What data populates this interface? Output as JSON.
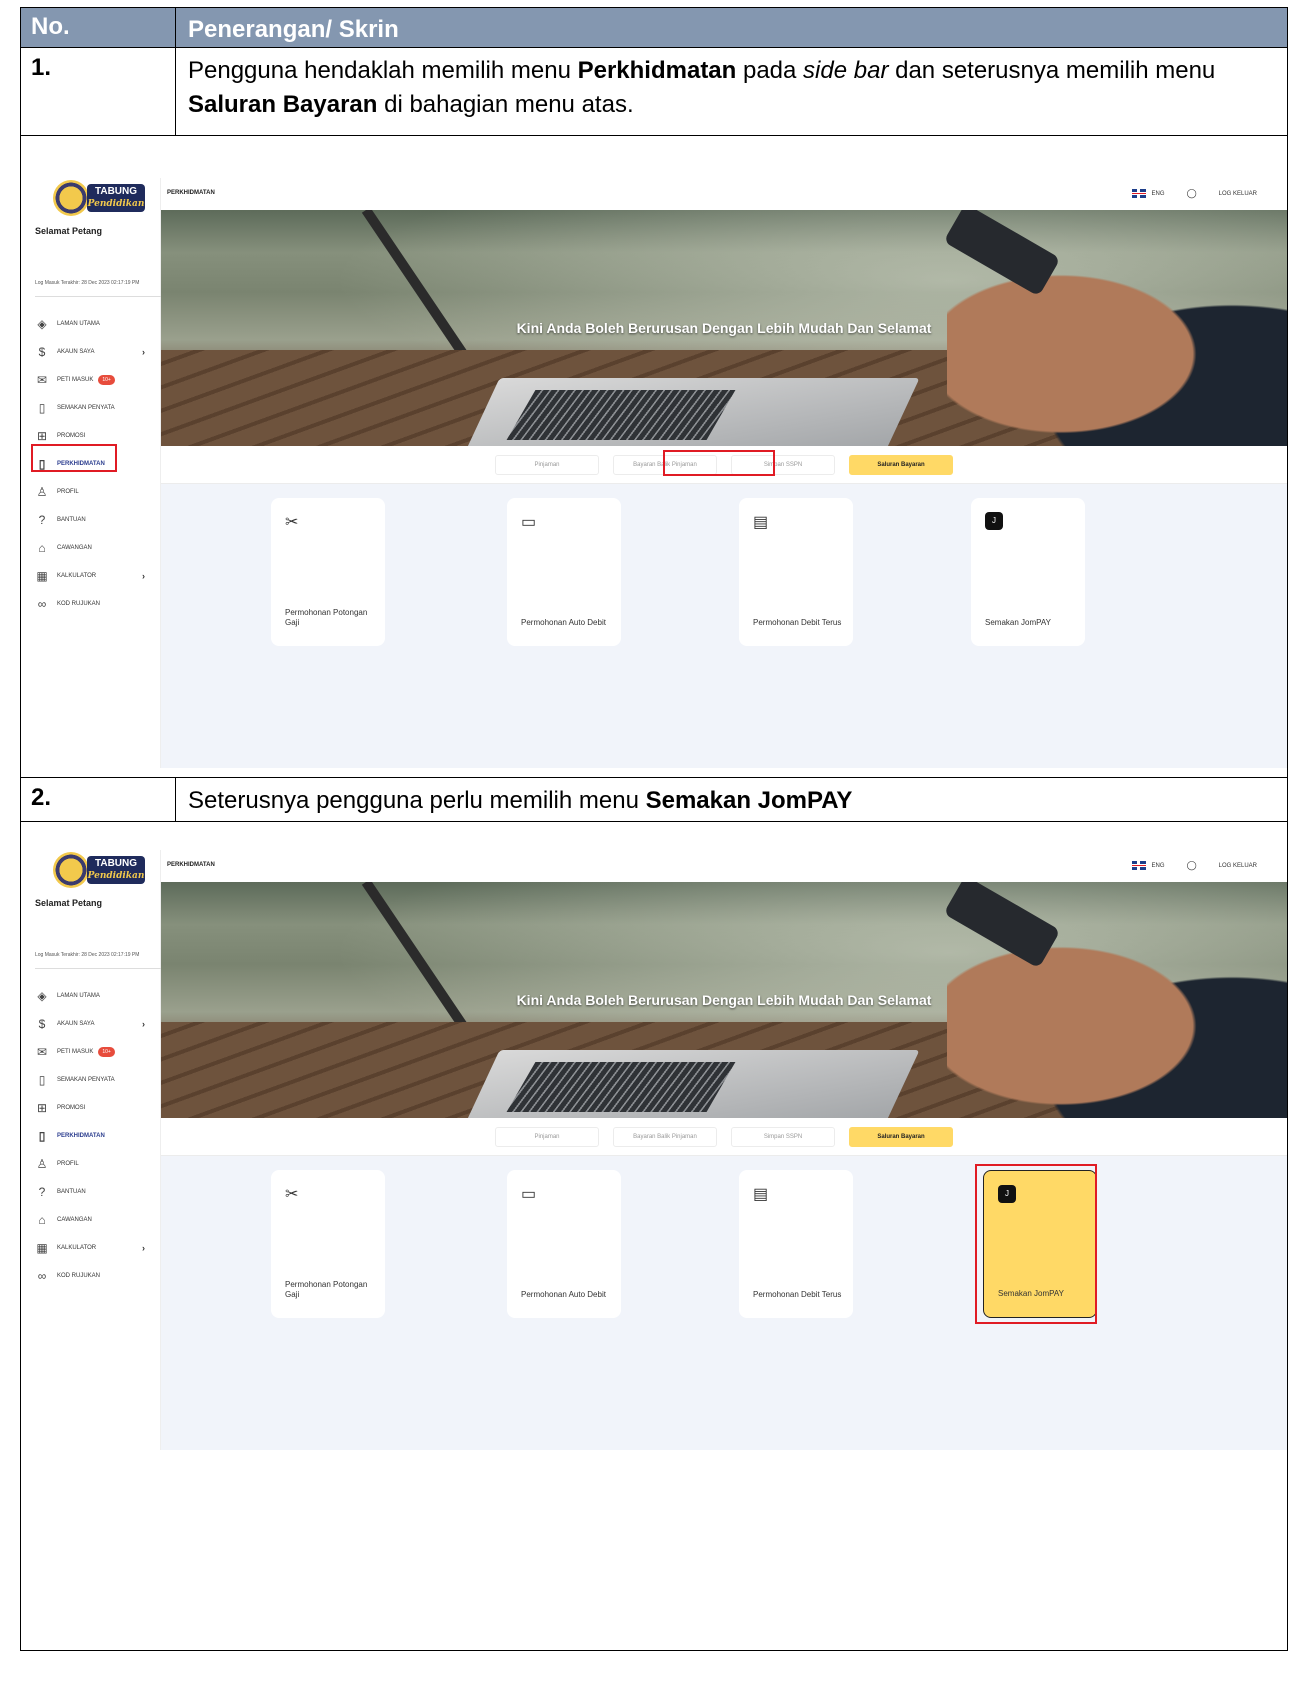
{
  "table": {
    "header": {
      "col1": "No.",
      "col2": "Penerangan/ Skrin"
    },
    "step1": {
      "num": "1.",
      "t1": "Pengguna hendaklah memilih menu ",
      "b1": "Perkhidmatan",
      "t2": " pada ",
      "i1": "side bar",
      "t3": " dan seterusnya memilih menu ",
      "b2": "Saluran Bayaran",
      "t4": " di bahagian menu atas."
    },
    "step2": {
      "num": "2.",
      "t1": "Seterusnya pengguna perlu memilih menu ",
      "b1": "Semakan JomPAY"
    }
  },
  "app": {
    "logo_main": "TABUNG",
    "logo_sub": "Pendidikan",
    "greeting": "Selamat Petang",
    "last_login": "Log Masuk Terakhir: 28 Dec 2023 02:17:19 PM",
    "menu": [
      {
        "label": "LAMAN UTAMA",
        "icon": "layers-icon"
      },
      {
        "label": "AKAUN SAYA",
        "icon": "dollar-circle-icon"
      },
      {
        "label": "PETI MASUK",
        "icon": "mail-icon",
        "badge": "10+"
      },
      {
        "label": "SEMAKAN PENYATA",
        "icon": "document-icon"
      },
      {
        "label": "PROMOSI",
        "icon": "gift-icon"
      },
      {
        "label": "PERKHIDMATAN",
        "icon": "phone-icon"
      },
      {
        "label": "PROFIL",
        "icon": "user-icon"
      },
      {
        "label": "BANTUAN",
        "icon": "help-icon"
      },
      {
        "label": "CAWANGAN",
        "icon": "building-icon"
      },
      {
        "label": "KALKULATOR",
        "icon": "calculator-icon"
      },
      {
        "label": "KOD RUJUKAN",
        "icon": "link-icon"
      }
    ],
    "page_title": "PERKHIDMATAN",
    "lang": "ENG",
    "logout": "LOG KELUAR",
    "banner_text": "Kini Anda Boleh Berurusan Dengan Lebih Mudah Dan Selamat",
    "tabs": [
      "Pinjaman",
      "Bayaran Balik Pinjaman",
      "Simpan SSPN",
      "Saluran Bayaran"
    ],
    "cards": [
      {
        "label": "Permohonan Potongan Gaji",
        "icon": "scissors-icon"
      },
      {
        "label": "Permohonan Auto Debit",
        "icon": "card-icon"
      },
      {
        "label": "Permohonan Debit Terus",
        "icon": "cards-icon"
      },
      {
        "label": "Semakan JomPAY",
        "icon": "jompay-icon"
      }
    ],
    "colors": {
      "accent": "#ffd966",
      "highlight_box": "#e01b24",
      "table_header": "#8497b0"
    }
  }
}
